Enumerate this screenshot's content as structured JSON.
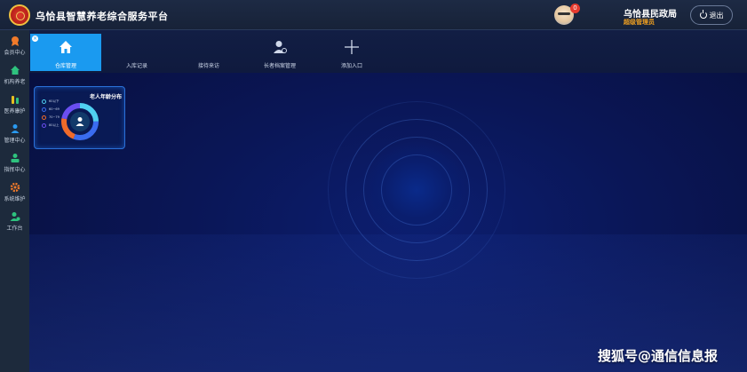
{
  "header": {
    "app_title": "乌恰县智慧养老综合服务平台",
    "notification_count": "0",
    "org_name": "乌恰县民政局",
    "user_role": "超级管理员",
    "logout_label": "退出"
  },
  "sidebar": {
    "items": [
      {
        "label": "会员中心",
        "icon": "badge-icon",
        "color": "#f07a2a"
      },
      {
        "label": "机构养老",
        "icon": "home-icon",
        "color": "#2ec27e"
      },
      {
        "label": "医养康护",
        "icon": "medicine-icon",
        "color": "#e6c020"
      },
      {
        "label": "管理中心",
        "icon": "user-settings-icon",
        "color": "#2a9af0"
      },
      {
        "label": "指挥中心",
        "icon": "command-icon",
        "color": "#2ec27e"
      },
      {
        "label": "系统维护",
        "icon": "gear-icon",
        "color": "#f07a2a"
      },
      {
        "label": "工作台",
        "icon": "users-icon",
        "color": "#2ec27e"
      }
    ]
  },
  "tabs": [
    {
      "label": "仓库管理",
      "icon": "home-icon",
      "active": true
    },
    {
      "label": "入库记录",
      "icon": "",
      "active": false
    },
    {
      "label": "接待来访",
      "icon": "",
      "active": false
    },
    {
      "label": "长者档案管理",
      "icon": "user-edit-icon",
      "active": false
    },
    {
      "label": "添加入口",
      "icon": "plus-icon",
      "active": false
    }
  ],
  "widget": {
    "title": "老人年龄分布",
    "legend": [
      {
        "label": "60以下",
        "color": "#4fd0f0"
      },
      {
        "label": "60~69",
        "color": "#3a6cf0"
      },
      {
        "label": "70~79",
        "color": "#f06a2a"
      },
      {
        "label": "80以上",
        "color": "#6a4ef0"
      }
    ]
  },
  "watermark": "搜狐号@通信信息报"
}
